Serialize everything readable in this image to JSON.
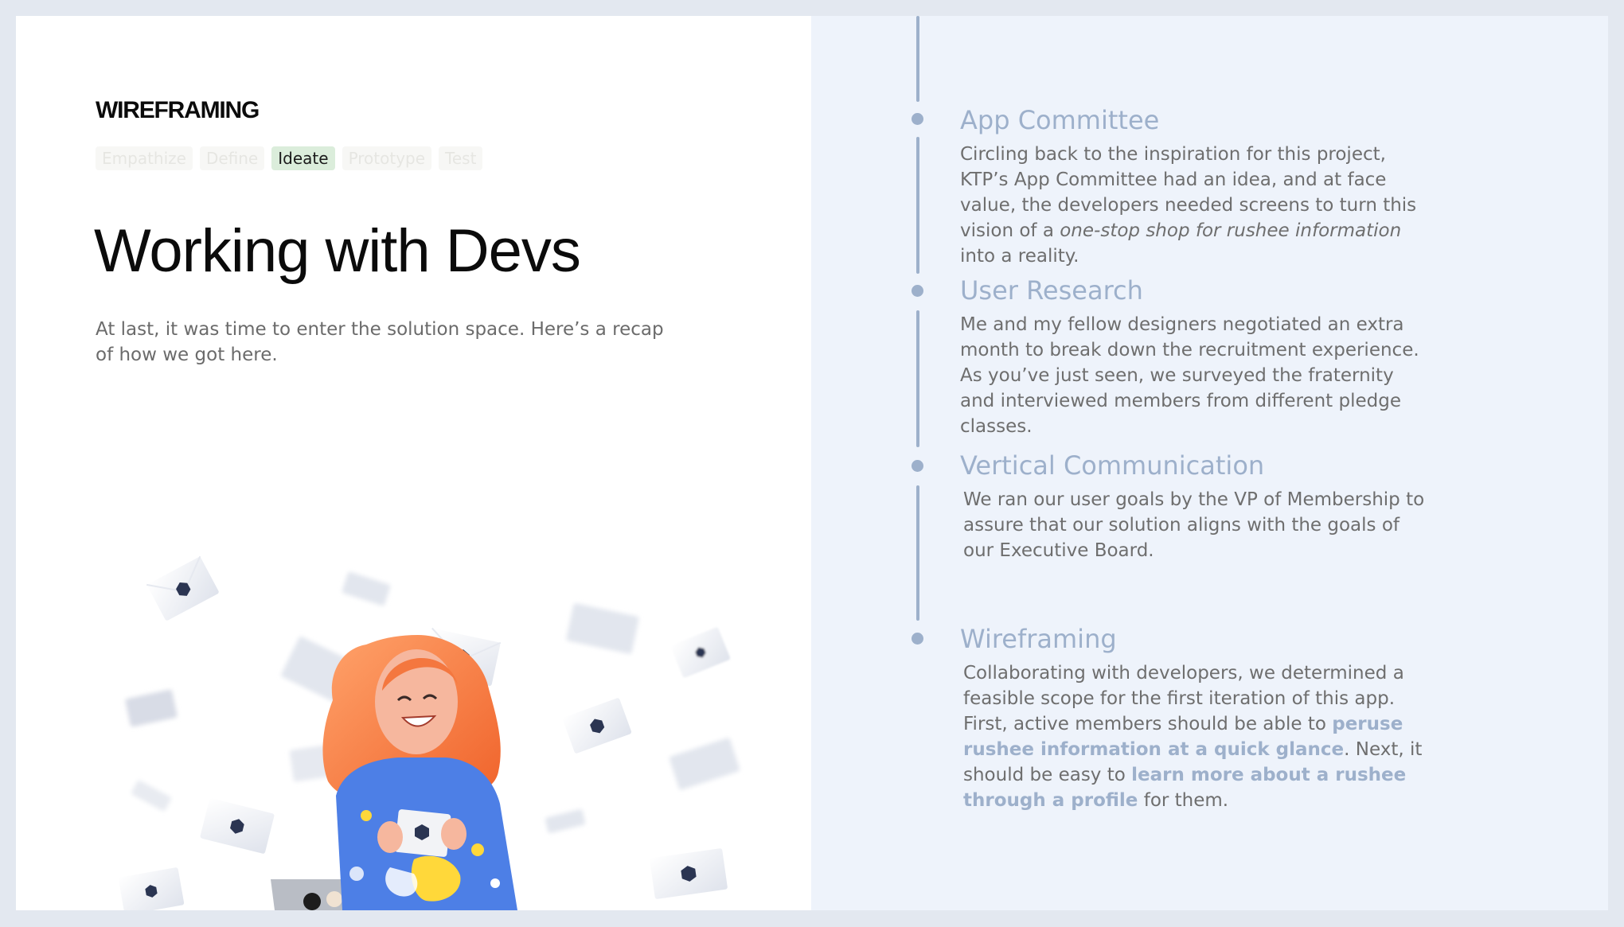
{
  "section_label": "WIREFRAMING",
  "phases": [
    {
      "label": "Empathize",
      "active": false
    },
    {
      "label": "Define",
      "active": false
    },
    {
      "label": "Ideate",
      "active": true
    },
    {
      "label": "Prototype",
      "active": false
    },
    {
      "label": "Test",
      "active": false
    }
  ],
  "title": "Working with Devs",
  "intro": "At last, it was time to enter the solution space. Here’s a recap of how we got here.",
  "illustration": "girl-with-flying-envelopes",
  "colors": {
    "accent": "#9db0cb",
    "active_tab_bg": "#dbeddb",
    "right_panel_bg": "#eef3fb"
  },
  "timeline": [
    {
      "heading": "App Committee",
      "body_parts": [
        {
          "text": "Circling back to the inspiration for this project, KTP’s App Committee had an idea, and at face value, the developers needed screens to turn this vision of a ",
          "style": "normal"
        },
        {
          "text": "one-stop shop for rushee information",
          "style": "italic"
        },
        {
          "text": " into a reality.",
          "style": "normal"
        }
      ]
    },
    {
      "heading": "User Research",
      "body_parts": [
        {
          "text": "Me and my fellow designers negotiated an extra month to break down the recruitment experience. As you’ve just seen, we surveyed the fraternity and interviewed members from different pledge classes.",
          "style": "normal"
        }
      ]
    },
    {
      "heading": "Vertical Communication",
      "body_parts": [
        {
          "text": "We ran our user goals by the VP of Membership to assure that our solution aligns with the goals of our Executive Board.",
          "style": "normal"
        }
      ]
    },
    {
      "heading": "Wireframing",
      "body_parts": [
        {
          "text": "Collaborating with developers, we determined a feasible scope for the first iteration of this app. First, active members should be able to ",
          "style": "normal"
        },
        {
          "text": "peruse rushee information at a quick glance",
          "style": "highlight"
        },
        {
          "text": ". Next, it should be easy to ",
          "style": "normal"
        },
        {
          "text": "learn more about a rushee through a profile",
          "style": "highlight"
        },
        {
          "text": " for them.",
          "style": "normal"
        }
      ]
    }
  ]
}
